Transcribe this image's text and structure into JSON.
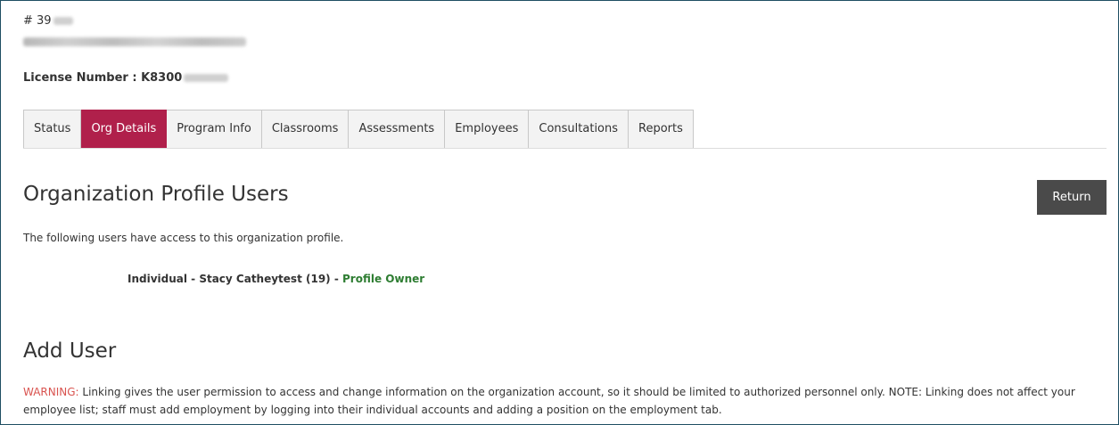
{
  "header": {
    "record_id": "# 39",
    "license_label": "License Number : K8300"
  },
  "tabs": [
    {
      "label": "Status",
      "active": false
    },
    {
      "label": "Org Details",
      "active": true
    },
    {
      "label": "Program Info",
      "active": false
    },
    {
      "label": "Classrooms",
      "active": false
    },
    {
      "label": "Assessments",
      "active": false
    },
    {
      "label": "Employees",
      "active": false
    },
    {
      "label": "Consultations",
      "active": false
    },
    {
      "label": "Reports",
      "active": false
    }
  ],
  "profile_users": {
    "title": "Organization Profile Users",
    "return_label": "Return",
    "intro": "The following users have access to this organization profile.",
    "user_text": "Individual - Stacy Catheytest (19) - ",
    "user_role": "Profile Owner"
  },
  "add_user": {
    "title": "Add User",
    "warning_label": "WARNING:",
    "warning_text": " Linking gives the user permission to access and change information on the organization account, so it should be limited to authorized personnel only. NOTE: Linking does not affect your employee list; staff must add employment by logging into their individual accounts and adding a position on the employment tab."
  },
  "colors": {
    "active_tab": "#b0204b",
    "return_button": "#4a4a4a",
    "role_green": "#2e7d32",
    "warning_red": "#d9534f",
    "frame_border": "#1f4f63"
  }
}
